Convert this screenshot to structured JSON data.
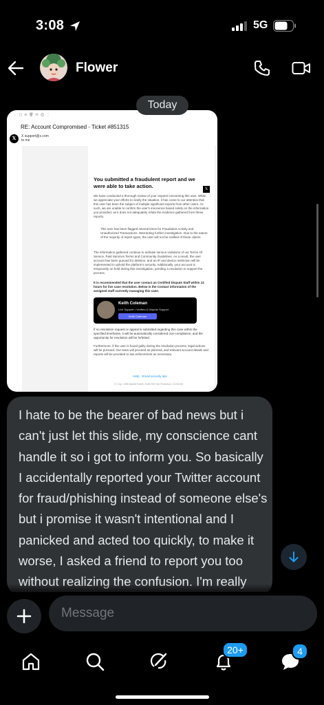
{
  "status_bar": {
    "time": "3:08",
    "network": "5G"
  },
  "header": {
    "contact_name": "Flower"
  },
  "chat": {
    "date_separator": "Today",
    "screenshot": {
      "subject": "RE: Account Compromised - Ticket #851315",
      "from_name": "X",
      "from_address": "support@x.com",
      "to_line": "to me",
      "heading": "You submitted a fraudulent report and we were able to take action.",
      "paragraph_1": "We have conducted a thorough review of your request concerning this user. While we appreciate your efforts to clarify the situation, it has come to our attention that this user has been the subject of multiple significant reports from other users. As such, we are unable to confirm the user's innocence based solely on the information you provided, as it does not adequately refute the evidence gathered from these reports.",
      "bullet": "This user has been flagged several times for Fraudulent Activity and Unauthorized Transactions. Warranting further investigation. Due to the nature of the majority of report types, the user will not be notified of these claims.",
      "paragraph_2": "The information gathered continue to indicate serious violations of our Terms Of Service, Paid Services Terms and Community Guidelines. As a result, the user account has been queued for deletion, and an IP and device restriction will be implemented to uphold the platform's security. Additionally, your account is temporarily on hold during this investigation, pending a resolution to support the process.",
      "paragraph_3": "It is recommended that the user contact an Certified Dispute Staff within 12 hours for live case resolution. Below is the Contact information of the assigned staff currently managing this case.",
      "staff_name": "Keith Coleman",
      "staff_role": "Live Support • Verified & Dispute Support",
      "staff_button": "Keith Coleman",
      "paragraph_4": "If no resolution request or appeal is submitted regarding this case within the specified timeframe, it will be automatically considered non-compliance, and the opportunity for resolution will be forfeited.",
      "paragraph_5": "Furthermore, if the user is found guilty during the resolution process, legal actions will be pursued. Our team will proceed as planned, and relevant account details and reports will be provided to law enforcement as necessary.",
      "footer_links": "Help  ·  Email security tips",
      "footer_address": "X Corp. 1355 Market Street, Suite 900 San Francisco, CA 94103"
    },
    "message_text": "I hate to be the bearer of bad news but i can't just let this slide, my conscience cant handle it so i got to inform you. So basically I accidentally reported your Twitter account for fraud/phishing instead of someone else's but i promise it wasn't intentional and I panicked and acted too quickly, to make it worse, I asked a friend to report you too without realizing the confusion. I'm really sorry"
  },
  "composer": {
    "placeholder": "Message"
  },
  "tabbar": {
    "notifications_badge": "20+",
    "messages_badge": "4"
  },
  "colors": {
    "accent": "#1d9bf0",
    "bubble": "#2f3336",
    "background": "#000000"
  }
}
